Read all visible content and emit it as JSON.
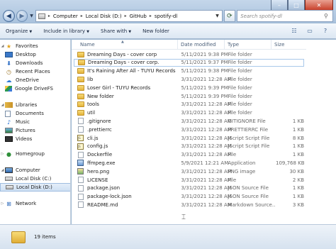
{
  "window": {
    "minimize_glyph": "–",
    "maximize_glyph": "□",
    "close_glyph": "✕"
  },
  "address": {
    "segments": [
      "Computer",
      "Local Disk (D:)",
      "GitHub",
      "spotify-dl"
    ],
    "separator": "▸"
  },
  "search": {
    "placeholder": "Search spotify-dl"
  },
  "toolbar": {
    "organize": "Organize",
    "include_in_library": "Include in library",
    "share_with": "Share with",
    "new_folder": "New folder"
  },
  "nav": {
    "favorites": "Favorites",
    "desktop": "Desktop",
    "downloads": "Downloads",
    "recent_places": "Recent Places",
    "onedrive": "OneDrive",
    "google_drive": "Google DriveFS",
    "libraries": "Libraries",
    "documents": "Documents",
    "music": "Music",
    "pictures": "Pictures",
    "videos": "Videos",
    "homegroup": "Homegroup",
    "computer": "Computer",
    "local_c": "Local Disk (C:)",
    "local_d": "Local Disk (D:)",
    "network": "Network"
  },
  "columns": {
    "name": "Name",
    "date_modified": "Date modified",
    "type": "Type",
    "size": "Size"
  },
  "files": [
    {
      "name": "Dreaming Days - cover corp",
      "date": "5/11/2021 9:38 PM",
      "type": "File folder",
      "size": "",
      "icon": "folder-icon"
    },
    {
      "name": "Dreaming Days - cover corp.",
      "date": "5/11/2021 9:37 PM",
      "type": "File folder",
      "size": "",
      "icon": "folder-icon"
    },
    {
      "name": "It's Raining After All - TUYU Records",
      "date": "5/11/2021 9:38 PM",
      "type": "File folder",
      "size": "",
      "icon": "folder-icon"
    },
    {
      "name": "lib",
      "date": "3/31/2021 12:28 AM",
      "type": "File folder",
      "size": "",
      "icon": "folder-icon"
    },
    {
      "name": "Loser Girl - TUYU Records",
      "date": "5/11/2021 9:39 PM",
      "type": "File folder",
      "size": "",
      "icon": "folder-icon"
    },
    {
      "name": "New folder",
      "date": "5/11/2021 9:39 PM",
      "type": "File folder",
      "size": "",
      "icon": "folder-icon"
    },
    {
      "name": "tools",
      "date": "3/31/2021 12:28 AM",
      "type": "File folder",
      "size": "",
      "icon": "folder-icon"
    },
    {
      "name": "util",
      "date": "3/31/2021 12:28 AM",
      "type": "File folder",
      "size": "",
      "icon": "folder-icon"
    },
    {
      "name": ".gitignore",
      "date": "3/31/2021 12:28 AM",
      "type": "GITIGNORE File",
      "size": "1 KB",
      "icon": "file-icon"
    },
    {
      "name": ".prettierrc",
      "date": "3/31/2021 12:28 AM",
      "type": "PRETTIERRC File",
      "size": "1 KB",
      "icon": "file-icon"
    },
    {
      "name": "cli.js",
      "date": "3/31/2021 12:28 AM",
      "type": "JScript Script File",
      "size": "8 KB",
      "icon": "js-file-icon"
    },
    {
      "name": "config.js",
      "date": "3/31/2021 12:28 AM",
      "type": "JScript Script File",
      "size": "1 KB",
      "icon": "js-file-icon"
    },
    {
      "name": "Dockerfile",
      "date": "3/31/2021 12:28 AM",
      "type": "File",
      "size": "1 KB",
      "icon": "file-icon"
    },
    {
      "name": "ffmpeg.exe",
      "date": "5/9/2021 12:21 AM",
      "type": "Application",
      "size": "109,768 KB",
      "icon": "exe-icon"
    },
    {
      "name": "hero.png",
      "date": "3/31/2021 12:28 AM",
      "type": "PNG image",
      "size": "30 KB",
      "icon": "png-icon"
    },
    {
      "name": "LICENSE",
      "date": "3/31/2021 12:28 AM",
      "type": "File",
      "size": "2 KB",
      "icon": "file-icon"
    },
    {
      "name": "package.json",
      "date": "3/31/2021 12:28 AM",
      "type": "JSON Source File",
      "size": "1 KB",
      "icon": "file-icon"
    },
    {
      "name": "package-lock.json",
      "date": "3/31/2021 12:28 AM",
      "type": "JSON Source File",
      "size": "1 KB",
      "icon": "file-icon"
    },
    {
      "name": "README.md",
      "date": "3/31/2021 12:28 AM",
      "type": "Markdown Source...",
      "size": "3 KB",
      "icon": "file-icon"
    }
  ],
  "status": {
    "item_count": "19 items"
  }
}
